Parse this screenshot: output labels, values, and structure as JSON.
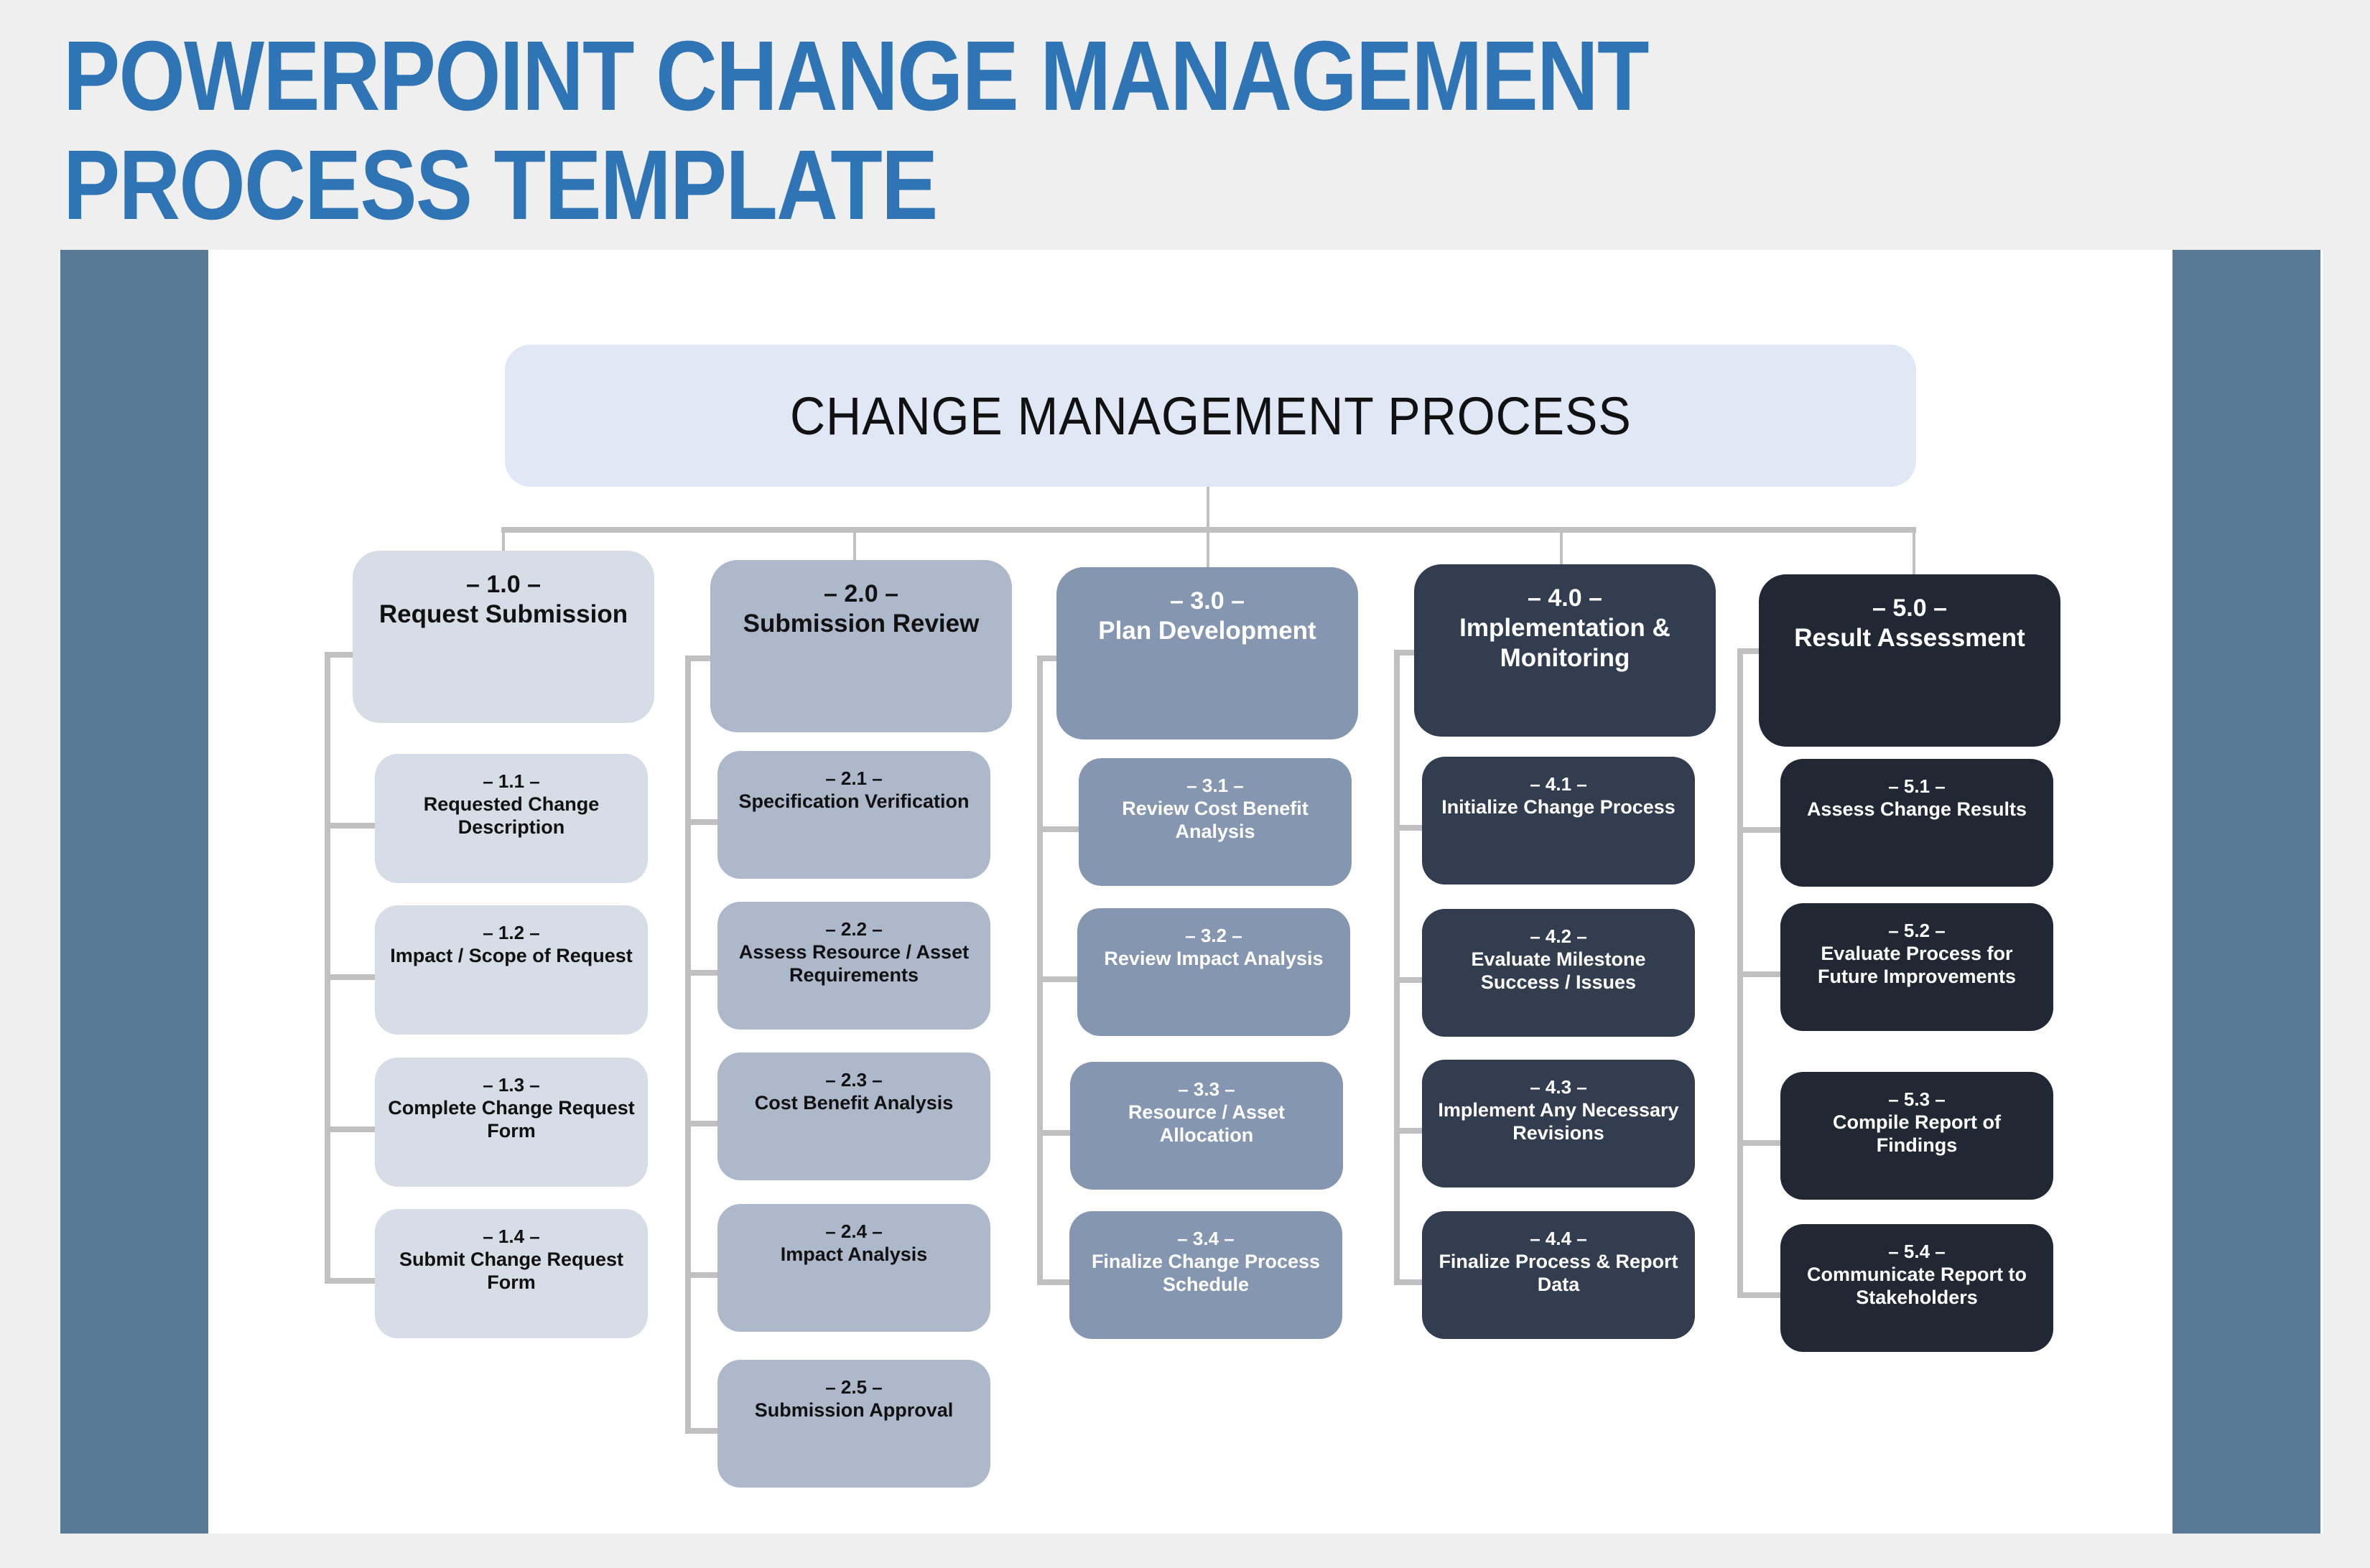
{
  "page": {
    "title_line1": "POWERPOINT CHANGE MANAGEMENT",
    "title_line2": "PROCESS TEMPLATE"
  },
  "colors": {
    "title": "#2f74b5",
    "sidebar": "#587a96",
    "top_box": "#dfe8f4",
    "connector": "#c0c0c0",
    "phase_1": "#d6dde6",
    "phase_2": "#adb9cb",
    "phase_3": "#8596b0",
    "phase_4": "#323d50",
    "phase_5": "#222833"
  },
  "diagram": {
    "root": "CHANGE MANAGEMENT PROCESS",
    "phases": [
      {
        "num": "– 1.0 –",
        "label": "Request Submission",
        "steps": [
          {
            "num": "– 1.1 –",
            "label": "Requested Change Description"
          },
          {
            "num": "– 1.2 –",
            "label": "Impact / Scope of Request"
          },
          {
            "num": "– 1.3 –",
            "label": "Complete Change Request Form"
          },
          {
            "num": "– 1.4 –",
            "label": "Submit Change Request Form"
          }
        ]
      },
      {
        "num": "– 2.0 –",
        "label": "Submission Review",
        "steps": [
          {
            "num": "– 2.1 –",
            "label": "Specification Verification"
          },
          {
            "num": "– 2.2 –",
            "label": "Assess Resource / Asset Requirements"
          },
          {
            "num": "– 2.3 –",
            "label": "Cost Benefit Analysis"
          },
          {
            "num": "– 2.4 –",
            "label": "Impact Analysis"
          },
          {
            "num": "– 2.5 –",
            "label": "Submission Approval"
          }
        ]
      },
      {
        "num": "– 3.0 –",
        "label": "Plan Development",
        "steps": [
          {
            "num": "– 3.1 –",
            "label": "Review Cost Benefit Analysis"
          },
          {
            "num": "– 3.2 –",
            "label": "Review Impact Analysis"
          },
          {
            "num": "– 3.3 –",
            "label": "Resource / Asset Allocation"
          },
          {
            "num": "– 3.4 –",
            "label": "Finalize Change Process Schedule"
          }
        ]
      },
      {
        "num": "– 4.0 –",
        "label": "Implementation & Monitoring",
        "steps": [
          {
            "num": "– 4.1 –",
            "label": "Initialize Change Process"
          },
          {
            "num": "– 4.2 –",
            "label": "Evaluate Milestone Success / Issues"
          },
          {
            "num": "– 4.3 –",
            "label": "Implement Any Necessary Revisions"
          },
          {
            "num": "– 4.4 –",
            "label": "Finalize Process & Report Data"
          }
        ]
      },
      {
        "num": "– 5.0 –",
        "label": "Result Assessment",
        "steps": [
          {
            "num": "– 5.1 –",
            "label": "Assess Change Results"
          },
          {
            "num": "– 5.2 –",
            "label": "Evaluate Process for Future Improvements"
          },
          {
            "num": "– 5.3 –",
            "label": "Compile Report of Findings"
          },
          {
            "num": "– 5.4 –",
            "label": "Communicate Report to Stakeholders"
          }
        ]
      }
    ]
  }
}
